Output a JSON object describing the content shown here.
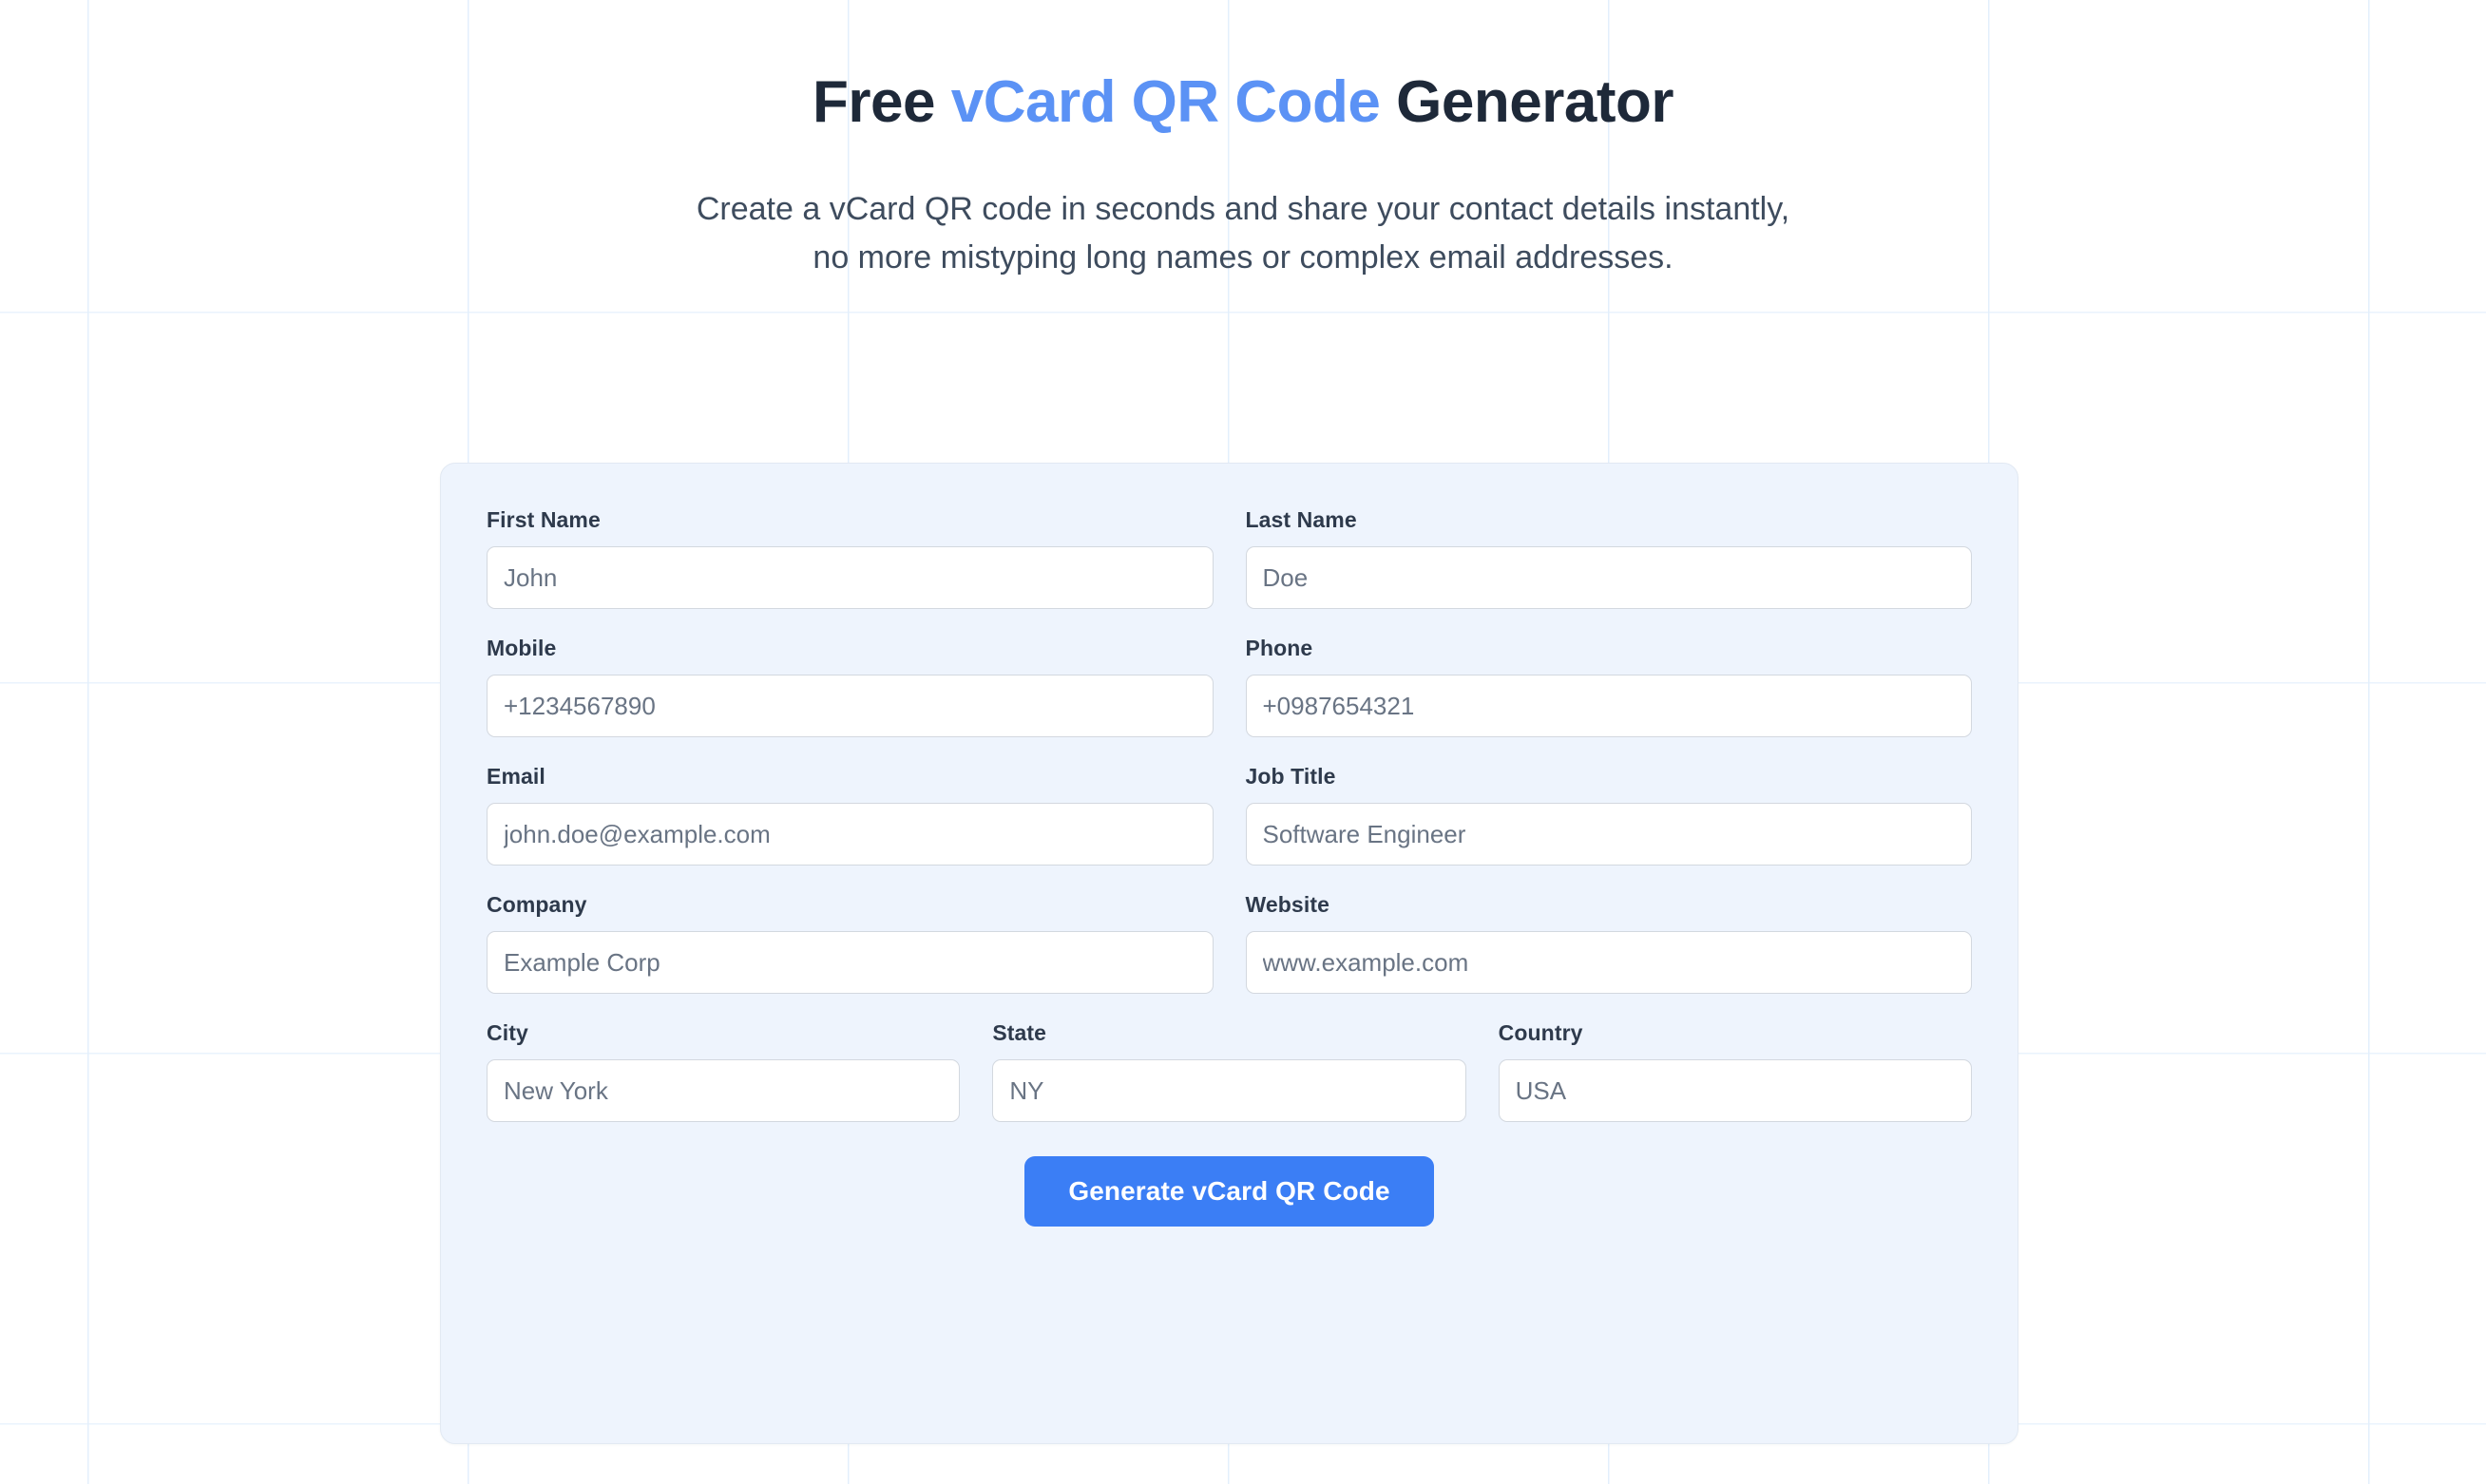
{
  "hero": {
    "title_part1": "Free ",
    "title_accent": "vCard QR Code",
    "title_part2": " Generator",
    "subtitle_line1": "Create a vCard QR code in seconds and share your contact details instantly,",
    "subtitle_line2": "no more mistyping long names or complex email addresses."
  },
  "colors": {
    "accent_blue": "#5b92f5",
    "title_dark": "#1e2939",
    "button_blue": "#3b7ef5",
    "card_bg": "#eef4fd",
    "grid_line": "#e3effc"
  },
  "form": {
    "rows": [
      {
        "fields": [
          {
            "label": "First Name",
            "placeholder": "John",
            "value": ""
          },
          {
            "label": "Last Name",
            "placeholder": "Doe",
            "value": ""
          }
        ]
      },
      {
        "fields": [
          {
            "label": "Mobile",
            "placeholder": "+1234567890",
            "value": ""
          },
          {
            "label": "Phone",
            "placeholder": "+0987654321",
            "value": ""
          }
        ]
      },
      {
        "fields": [
          {
            "label": "Email",
            "placeholder": "john.doe@example.com",
            "value": ""
          },
          {
            "label": "Job Title",
            "placeholder": "Software Engineer",
            "value": ""
          }
        ]
      },
      {
        "fields": [
          {
            "label": "Company",
            "placeholder": "Example Corp",
            "value": ""
          },
          {
            "label": "Website",
            "placeholder": "www.example.com",
            "value": ""
          }
        ]
      },
      {
        "fields": [
          {
            "label": "City",
            "placeholder": "New York",
            "value": ""
          },
          {
            "label": "State",
            "placeholder": "NY",
            "value": ""
          },
          {
            "label": "Country",
            "placeholder": "USA",
            "value": ""
          }
        ]
      }
    ],
    "submit_label": "Generate vCard QR Code"
  }
}
